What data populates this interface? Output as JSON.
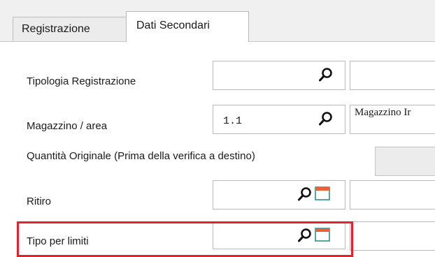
{
  "tabs": [
    {
      "label": "Registrazione",
      "active": false
    },
    {
      "label": "Dati Secondari",
      "active": true
    }
  ],
  "fields": {
    "tipologia": {
      "label": "Tipologia Registrazione",
      "value": "",
      "description": ""
    },
    "magazzino": {
      "label": "Magazzino / area",
      "value": "1.1",
      "description": "Magazzino Ir"
    },
    "quantita": {
      "label": "Quantità Originale (Prima della verifica a destino)",
      "value": ""
    },
    "ritiro": {
      "label": "Ritiro",
      "value": "",
      "description": ""
    },
    "tipo_limiti": {
      "label": "Tipo per limiti",
      "value": "",
      "description": ""
    }
  },
  "icons": {
    "lookup": "search-icon",
    "picker": "calendar-icon"
  },
  "colors": {
    "highlight": "#e0242b",
    "tab_strip": "#f0f0f0",
    "border": "#b9b9b9"
  }
}
